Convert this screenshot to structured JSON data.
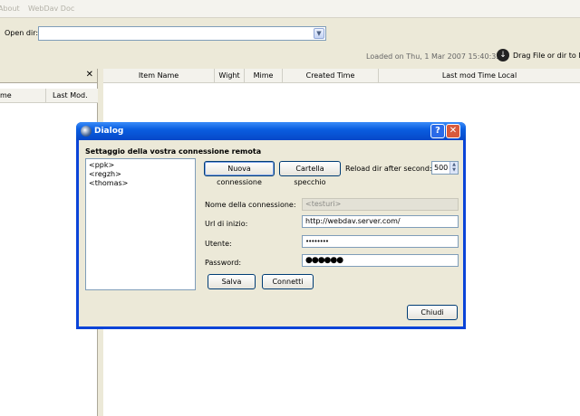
{
  "menu": {
    "about": "About",
    "webdav_doc": "WebDav Doc"
  },
  "toolbar": {
    "open_dir_label": "Open dir:",
    "open_dir_value": "",
    "status": "Loaded on Thu, 1 Mar 2007 15:40:32",
    "drag_label": "Drag File or dir to Ma"
  },
  "left_panel": {
    "col_name": "me",
    "col_last_mod": "Last Mod."
  },
  "file_table": {
    "columns": [
      "Item Name",
      "Wight",
      "Mime",
      "Created Time",
      "Last mod Time Local"
    ]
  },
  "dialog": {
    "title": "Dialog",
    "heading": "Settaggio della vostra connessione remota",
    "connections": [
      "<ppk>",
      "<regzh>",
      "<thomas>"
    ],
    "new_button": "Nuova connessione",
    "mirror_button": "Cartella specchio",
    "reload_label": "Reload dir after second:",
    "reload_value": "500",
    "name_label": "Nome della connessione:",
    "name_value": "<testuri>",
    "url_label": "Url di inizio:",
    "url_value": "http://webdav.server.com/",
    "user_label": "Utente:",
    "user_value": "••••••••",
    "password_label": "Password:",
    "password_value": "●●●●●●",
    "save_button": "Salva",
    "connect_button": "Connetti",
    "close_button": "Chiudi"
  }
}
